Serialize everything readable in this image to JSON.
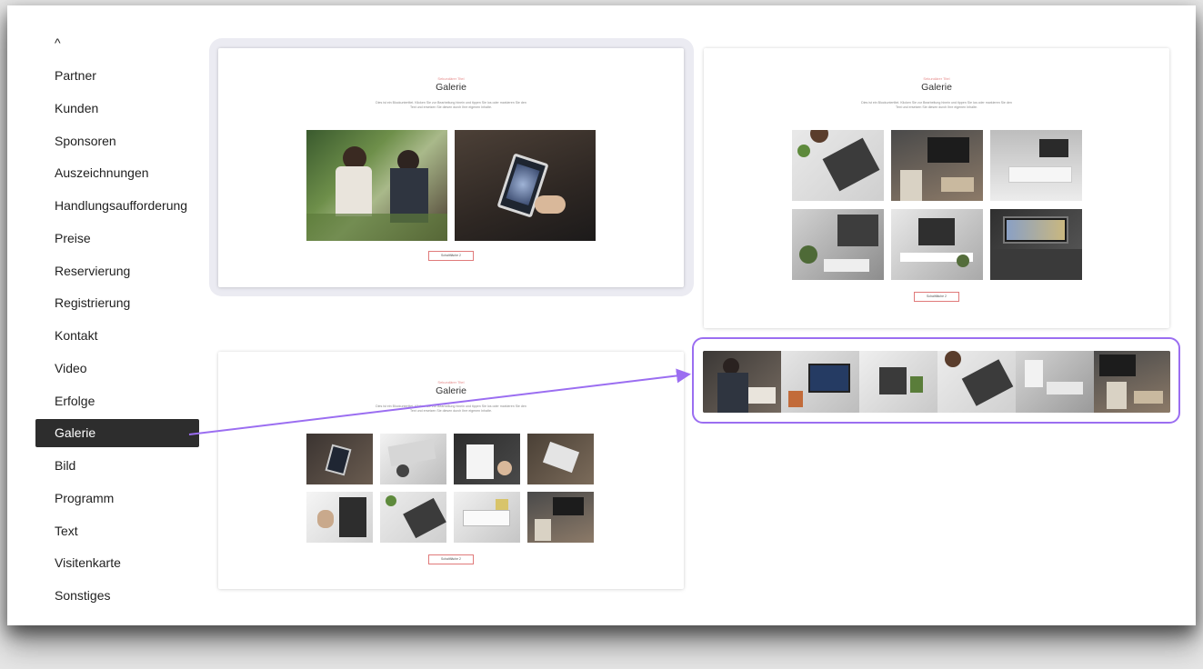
{
  "sidebar": {
    "collapse_glyph": "^",
    "items": [
      {
        "label": "Partner"
      },
      {
        "label": "Kunden"
      },
      {
        "label": "Sponsoren"
      },
      {
        "label": "Auszeichnungen"
      },
      {
        "label": "Handlungsaufforderung"
      },
      {
        "label": "Preise"
      },
      {
        "label": "Reservierung"
      },
      {
        "label": "Registrierung"
      },
      {
        "label": "Kontakt"
      },
      {
        "label": "Video"
      },
      {
        "label": "Erfolge"
      },
      {
        "label": "Galerie",
        "active": true
      },
      {
        "label": "Bild"
      },
      {
        "label": "Programm"
      },
      {
        "label": "Text"
      },
      {
        "label": "Visitenkarte"
      },
      {
        "label": "Sonstiges"
      }
    ]
  },
  "cards": [
    {
      "subtitle": "Sekundärer Titel",
      "title": "Galerie",
      "description": "Dies ist ein Blockuntertitel. Klicken Sie zur Bearbeitung hinein und tippen Sie los oder markieren Sie den Text und ersetzen Sie diesen durch Ihre eigenen Inhalte.",
      "button": "Schaltfläche 2"
    },
    {
      "subtitle": "Sekundärer Titel",
      "title": "Galerie",
      "description": "Dies ist ein Blockuntertitel. Klicken Sie zur Bearbeitung hinein und tippen Sie los oder markieren Sie den Text und ersetzen Sie diesen durch Ihre eigenen Inhalte.",
      "button": "Schaltfläche 2"
    },
    {
      "subtitle": "Sekundärer Titel",
      "title": "Galerie",
      "description": "Dies ist ein Blockuntertitel. Klicken Sie zur Bearbeitung hinein und tippen Sie los oder markieren Sie den Text und ersetzen Sie diesen durch Ihre eigenen Inhalte.",
      "button": "Schaltfläche 2"
    }
  ],
  "colors": {
    "accent": "#9b6ef1",
    "active_item_bg": "#2d2d2d",
    "button_border": "#e07a7a"
  }
}
